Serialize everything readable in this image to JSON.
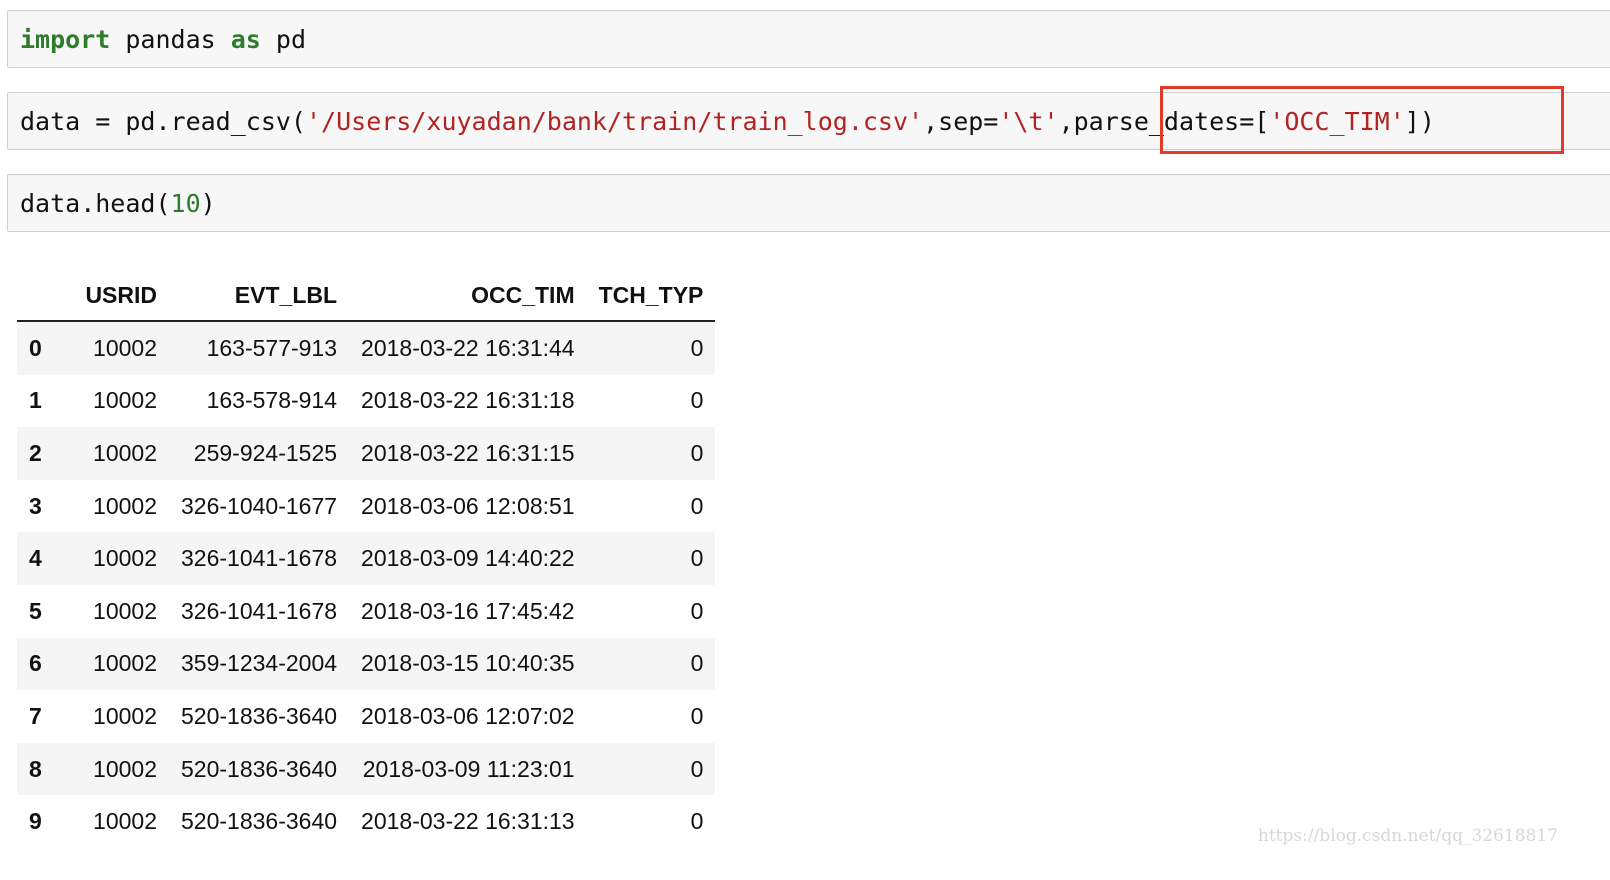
{
  "cells": [
    {
      "tokens": [
        {
          "text": "import",
          "cls": "kw"
        },
        {
          "text": " pandas ",
          "cls": ""
        },
        {
          "text": "as",
          "cls": "kw"
        },
        {
          "text": " pd",
          "cls": ""
        }
      ]
    },
    {
      "tokens": [
        {
          "text": "data = pd.read_csv(",
          "cls": ""
        },
        {
          "text": "'/Users/xuyadan/bank/train/train_log.csv'",
          "cls": "str"
        },
        {
          "text": ",sep=",
          "cls": ""
        },
        {
          "text": "'\\t'",
          "cls": "str"
        },
        {
          "text": ",parse_dates=[",
          "cls": ""
        },
        {
          "text": "'OCC_TIM'",
          "cls": "str"
        },
        {
          "text": "])",
          "cls": ""
        }
      ]
    },
    {
      "tokens": [
        {
          "text": "data.head(",
          "cls": ""
        },
        {
          "text": "10",
          "cls": "num"
        },
        {
          "text": ")",
          "cls": ""
        }
      ]
    }
  ],
  "table": {
    "columns": [
      "USRID",
      "EVT_LBL",
      "OCC_TIM",
      "TCH_TYP"
    ],
    "rows": [
      {
        "index": "0",
        "values": [
          "10002",
          "163-577-913",
          "2018-03-22 16:31:44",
          "0"
        ]
      },
      {
        "index": "1",
        "values": [
          "10002",
          "163-578-914",
          "2018-03-22 16:31:18",
          "0"
        ]
      },
      {
        "index": "2",
        "values": [
          "10002",
          "259-924-1525",
          "2018-03-22 16:31:15",
          "0"
        ]
      },
      {
        "index": "3",
        "values": [
          "10002",
          "326-1040-1677",
          "2018-03-06 12:08:51",
          "0"
        ]
      },
      {
        "index": "4",
        "values": [
          "10002",
          "326-1041-1678",
          "2018-03-09 14:40:22",
          "0"
        ]
      },
      {
        "index": "5",
        "values": [
          "10002",
          "326-1041-1678",
          "2018-03-16 17:45:42",
          "0"
        ]
      },
      {
        "index": "6",
        "values": [
          "10002",
          "359-1234-2004",
          "2018-03-15 10:40:35",
          "0"
        ]
      },
      {
        "index": "7",
        "values": [
          "10002",
          "520-1836-3640",
          "2018-03-06 12:07:02",
          "0"
        ]
      },
      {
        "index": "8",
        "values": [
          "10002",
          "520-1836-3640",
          "2018-03-09 11:23:01",
          "0"
        ]
      },
      {
        "index": "9",
        "values": [
          "10002",
          "520-1836-3640",
          "2018-03-22 16:31:13",
          "0"
        ]
      }
    ]
  },
  "highlight_color": "#e23a2a",
  "watermark": "https://blog.csdn.net/qq_32618817"
}
